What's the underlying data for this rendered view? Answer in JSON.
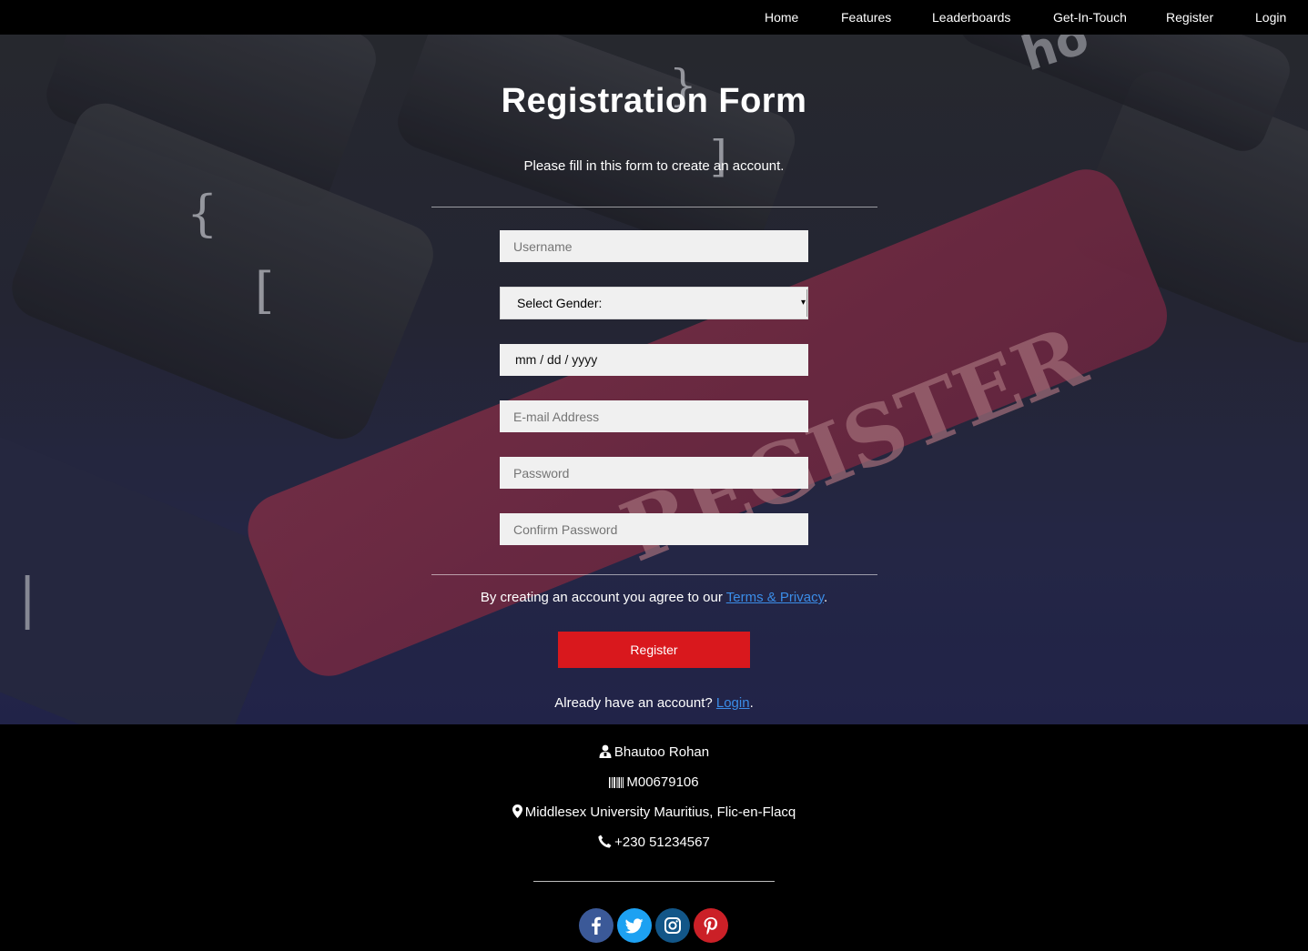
{
  "nav": {
    "items": [
      "Home",
      "Features",
      "Leaderboards",
      "Get-In-Touch",
      "Register",
      "Login"
    ]
  },
  "form": {
    "title": "Registration Form",
    "subtitle": "Please fill in this form to create an account.",
    "username_placeholder": "Username",
    "gender_selected": "Select Gender:",
    "date_placeholder": "mm / dd / yyyy",
    "email_placeholder": "E-mail Address",
    "password_placeholder": "Password",
    "confirm_password_placeholder": "Confirm Password",
    "terms_prefix": "By creating an account you agree to our ",
    "terms_link": "Terms & Privacy",
    "terms_suffix": ".",
    "register_label": "Register",
    "login_prefix": "Already have an account? ",
    "login_link": "Login",
    "login_suffix": "."
  },
  "footer": {
    "name": "Bhautoo Rohan",
    "student_id": "M00679106",
    "address": "Middlesex University Mauritius, Flic-en-Flacq",
    "phone": "+230 51234567",
    "social": [
      "facebook-icon",
      "twitter-icon",
      "instagram-icon",
      "pinterest-icon"
    ]
  },
  "colors": {
    "register_button": "#d9181d",
    "link": "#3b8de8",
    "facebook": "#3b5998",
    "twitter": "#1da1f2",
    "instagram": "#125688",
    "pinterest": "#cb2027"
  }
}
